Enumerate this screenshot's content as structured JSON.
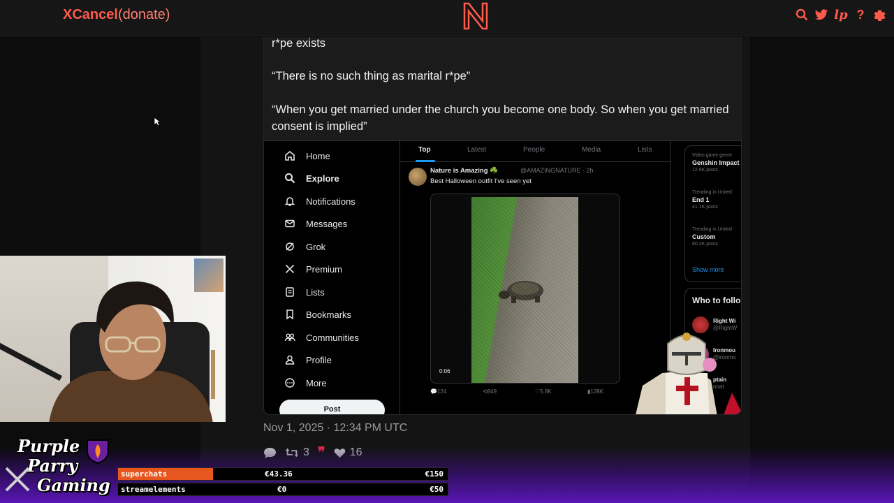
{
  "header": {
    "brand_name": "XCancel",
    "brand_suffix": "(donate)",
    "logo_letter": "N",
    "icons": [
      "search-icon",
      "twitter-icon",
      "lp-icon",
      "help-icon",
      "settings-icon"
    ],
    "lp_label": "lp",
    "help_label": "?",
    "accent_color": "#ff5a4a"
  },
  "tweet": {
    "paragraphs": [
      "r*pe exists",
      "“There is no such thing as marital r*pe”",
      "“When you get married under the church you become one body. So when you get married consent is implied”"
    ],
    "date": "Nov 1, 2025 · 12:34 PM UTC",
    "stats": {
      "retweets": "3",
      "likes": "16"
    }
  },
  "embedded_screenshot": {
    "nav_items": [
      {
        "label": "Home",
        "icon": "home-icon"
      },
      {
        "label": "Explore",
        "icon": "search-icon"
      },
      {
        "label": "Notifications",
        "icon": "bell-icon"
      },
      {
        "label": "Messages",
        "icon": "mail-icon"
      },
      {
        "label": "Grok",
        "icon": "grok-icon"
      },
      {
        "label": "Premium",
        "icon": "x-icon"
      },
      {
        "label": "Lists",
        "icon": "list-icon"
      },
      {
        "label": "Bookmarks",
        "icon": "bookmark-icon"
      },
      {
        "label": "Communities",
        "icon": "communities-icon"
      },
      {
        "label": "Profile",
        "icon": "profile-icon"
      },
      {
        "label": "More",
        "icon": "more-icon"
      }
    ],
    "post_button": "Post",
    "tabs": [
      "Top",
      "Latest",
      "People",
      "Media",
      "Lists"
    ],
    "post": {
      "author": "Nature is Amazing ☘️",
      "handle": "@AMAZINGNATURE · 2h",
      "text": "Best Halloween outfit I've seen yet",
      "video_time": "0:06",
      "replies": "124",
      "reposts": "849",
      "likes": "5.8K",
      "views": "128K"
    },
    "trends": [
      {
        "context": "Video game genre",
        "name": "Genshin Impact",
        "count": "12.6K posts"
      },
      {
        "context": "Trending in United",
        "name": "End 1",
        "count": "41.1K posts"
      },
      {
        "context": "Trending in United",
        "name": "Custom",
        "count": "60.2K posts"
      }
    ],
    "show_more": "Show more",
    "who_to_follow": "Who to follo",
    "follow_suggestions": [
      {
        "name": "Right Wi",
        "handle": "@RightW"
      },
      {
        "name": "Ironmou",
        "handle": "@ironmo"
      },
      {
        "name": "ptain",
        "handle": "nnat"
      }
    ]
  },
  "stream": {
    "channel_logo_lines": [
      "Purple",
      "Parry",
      "Gaming"
    ],
    "goals": [
      {
        "name": "superchats",
        "current": "€43.36",
        "target": "€150",
        "progress": 0.289
      },
      {
        "name": "streamelements",
        "current": "€0",
        "target": "€50",
        "progress": 0
      }
    ],
    "goal_fill_color": "#e8561f",
    "overlay_color": "#5c16be"
  }
}
